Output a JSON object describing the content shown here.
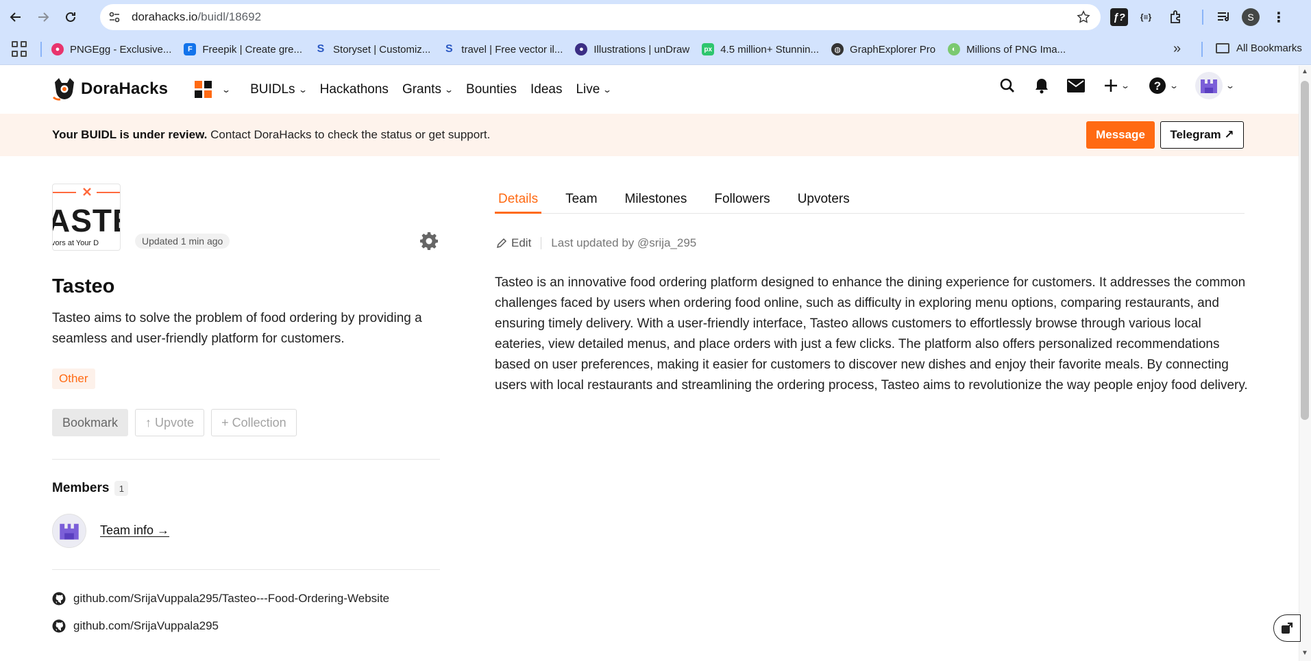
{
  "browser": {
    "url_domain": "dorahacks.io",
    "url_path": "/buidl/18692",
    "profile_initial": "S",
    "extensions": [
      "ƒ?",
      "{≡}"
    ],
    "bookmarks": [
      {
        "label": "PNGEgg - Exclusive...",
        "icon": "pngegg-icon",
        "color": "#e8346d"
      },
      {
        "label": "Freepik | Create gre...",
        "icon": "freepik-icon",
        "color": "#1273eb"
      },
      {
        "label": "Storyset | Customiz...",
        "icon": "storyset-icon",
        "color": "#2b59c3"
      },
      {
        "label": "travel | Free vector il...",
        "icon": "storyset-icon",
        "color": "#2b59c3"
      },
      {
        "label": "Illustrations | unDraw",
        "icon": "undraw-icon",
        "color": "#6c63ff"
      },
      {
        "label": "4.5 million+ Stunnin...",
        "icon": "pixabay-icon",
        "color": "#2ec66e"
      },
      {
        "label": "GraphExplorer Pro",
        "icon": "globe-icon",
        "color": "#333333"
      },
      {
        "label": "Millions of PNG Ima...",
        "icon": "pngmart-icon",
        "color": "#7bc96f"
      }
    ],
    "more_label": "»",
    "all_bookmarks": "All Bookmarks"
  },
  "site": {
    "brand": "DoraHacks",
    "nav": [
      {
        "label": "BUIDLs",
        "dropdown": true
      },
      {
        "label": "Hackathons",
        "dropdown": false
      },
      {
        "label": "Grants",
        "dropdown": true
      },
      {
        "label": "Bounties",
        "dropdown": false
      },
      {
        "label": "Ideas",
        "dropdown": false
      },
      {
        "label": "Live",
        "dropdown": true
      }
    ],
    "accent": "#ff6a13"
  },
  "banner": {
    "bold": "Your BUIDL is under review.",
    "text": " Contact DoraHacks to check the status or get support.",
    "message_label": "Message",
    "telegram_label": "Telegram ↗"
  },
  "buidl": {
    "logo_text": "ASTE",
    "logo_sub": "vors at Your D",
    "updated": "Updated 1 min ago",
    "title": "Tasteo",
    "summary": "Tasteo aims to solve the problem of food ordering by providing a seamless and user-friendly platform for customers.",
    "tag": "Other",
    "actions": {
      "bookmark": "Bookmark",
      "upvote": "↑ Upvote",
      "collection": "+ Collection"
    },
    "members_label": "Members",
    "members_count": "1",
    "team_info": "Team info →",
    "links": [
      "github.com/SrijaVuppala295/Tasteo---Food-Ordering-Website",
      "github.com/SrijaVuppala295"
    ]
  },
  "tabs": [
    "Details",
    "Team",
    "Milestones",
    "Followers",
    "Upvoters"
  ],
  "details": {
    "edit_label": "Edit",
    "last_updated": "Last updated by @srija_295",
    "description": "Tasteo is an innovative food ordering platform designed to enhance the dining experience for customers. It addresses the common challenges faced by users when ordering food online, such as difficulty in exploring menu options, comparing restaurants, and ensuring timely delivery. With a user-friendly interface, Tasteo allows customers to effortlessly browse through various local eateries, view detailed menus, and place orders with just a few clicks. The platform also offers personalized recommendations based on user preferences, making it easier for customers to discover new dishes and enjoy their favorite meals. By connecting users with local restaurants and streamlining the ordering process, Tasteo aims to revolutionize the way people enjoy food delivery."
  }
}
